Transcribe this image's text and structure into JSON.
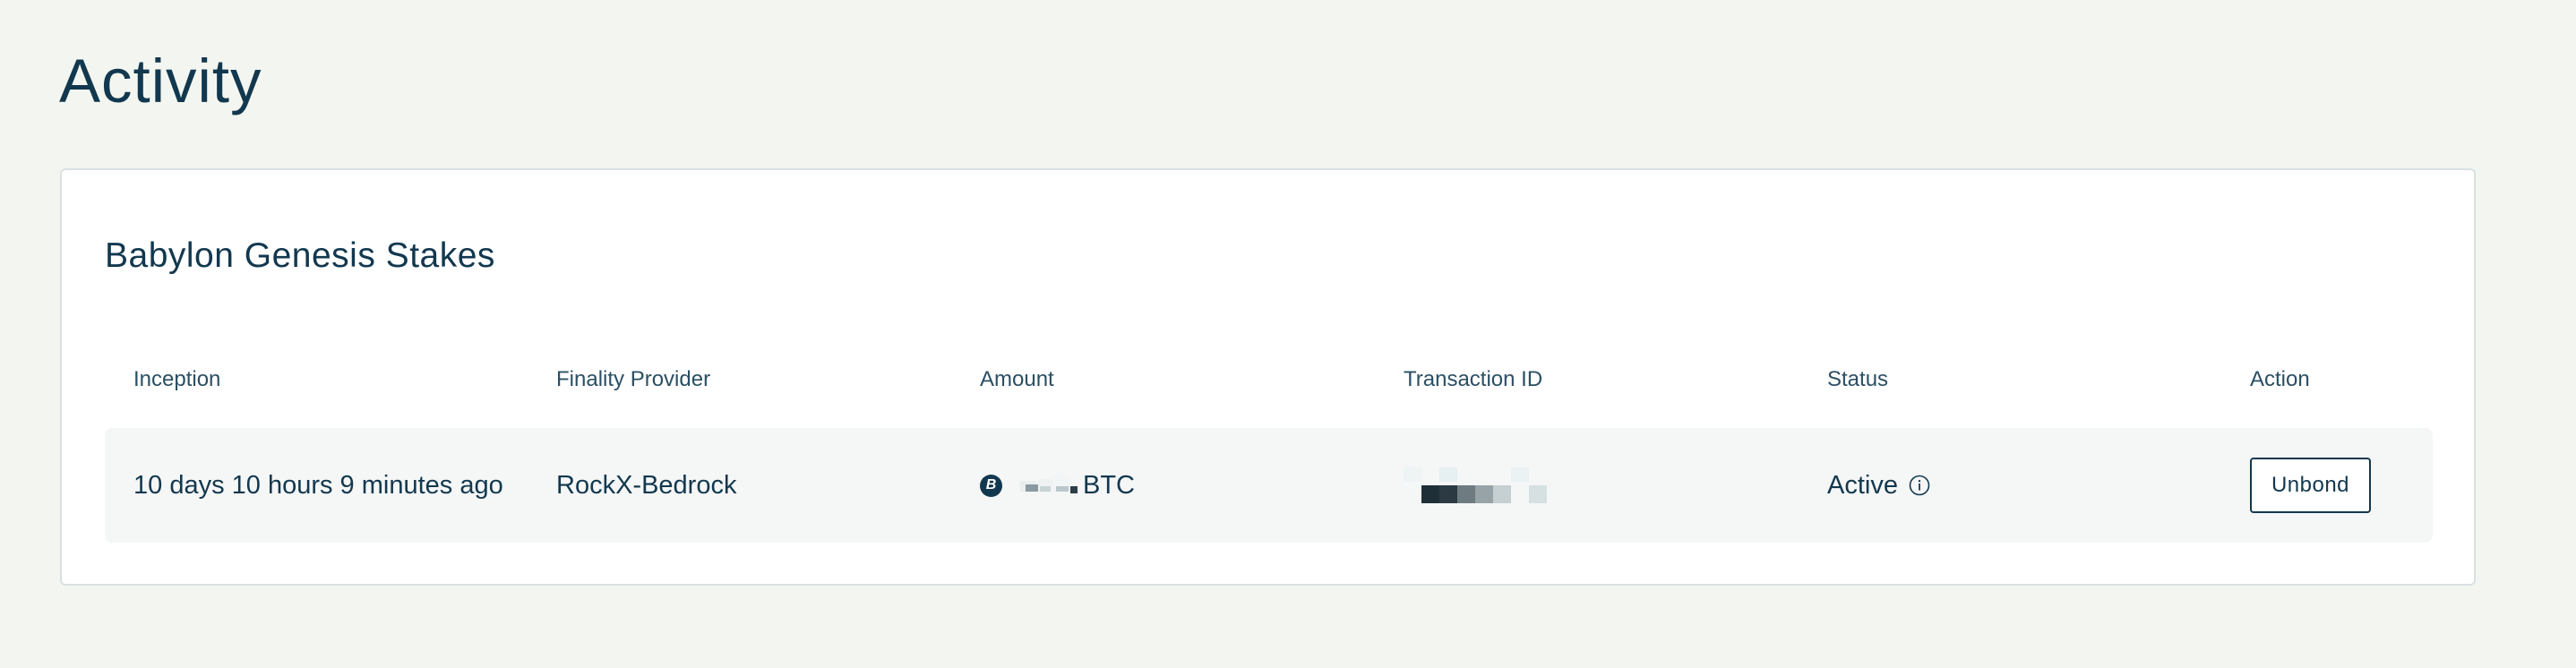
{
  "page": {
    "title": "Activity"
  },
  "stakes_card": {
    "title": "Babylon Genesis Stakes",
    "columns": [
      "Inception",
      "Finality Provider",
      "Amount",
      "Transaction ID",
      "Status",
      "Action"
    ],
    "rows": [
      {
        "inception": "10 days 10 hours 9 minutes ago",
        "finality_provider": "RockX-Bedrock",
        "amount_unit": "BTC",
        "status": "Active",
        "action_label": "Unbond"
      }
    ]
  },
  "icons": {
    "btc": "bitcoin-icon",
    "info": "info-circle-icon"
  },
  "colors": {
    "background": "#f3f6f0",
    "text_primary": "#12384f",
    "card_background": "#ffffff",
    "row_background": "#f5f6f6"
  }
}
